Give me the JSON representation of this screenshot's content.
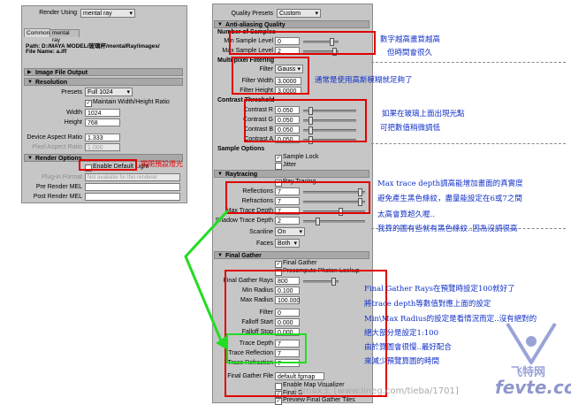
{
  "left_panel": {
    "render_using_label": "Render Using",
    "render_using_value": "mental ray",
    "tabs": [
      "Common",
      "mental ray"
    ],
    "path": "Path: D:/MAYA MODEL/玻璃杯/mentalRay/images/",
    "file_name": "File Name:     a.iff",
    "sections": {
      "image_file_output": "Image File Output",
      "resolution": "Resolution",
      "render_options": "Render Options"
    },
    "presets_label": "Presets",
    "presets_value": "Full 1024",
    "maintain_ratio": "Maintain Width/Height Ratio",
    "width_label": "Width",
    "width_value": "1024",
    "height_label": "Height",
    "height_value": "768",
    "device_aspect_label": "Device Aspect Ratio",
    "device_aspect_value": "1.333",
    "pixel_aspect_label": "Pixel Aspect Ratio",
    "pixel_aspect_value": "1.000",
    "enable_default_light": "Enable Default Light",
    "plugin_format_label": "Plug-in Format",
    "plugin_format_value": "Not available for this renderer",
    "pre_render_label": "Pre Render MEL",
    "post_render_label": "Post Render MEL",
    "note_default_light": "關閉預設燈光"
  },
  "right_panel": {
    "quality_presets_label": "Quality Presets",
    "quality_presets_value": "Custom",
    "antialias_head": "Anti-aliasing Quality",
    "num_samples_head": "Number of Samples",
    "min_sample_label": "Min Sample Level",
    "min_sample_value": "0",
    "max_sample_label": "Max Sample Level",
    "max_sample_value": "2",
    "multipixel_head": "Multi-pixel Filtering",
    "filter_label": "Filter",
    "filter_value": "Gauss",
    "filter_width_label": "Filter Width",
    "filter_width_value": "3.0000",
    "filter_height_label": "Filter Height",
    "filter_height_value": "3.0000",
    "contrast_head": "Contrast Threshold",
    "contrast_rows": [
      {
        "label": "Contrast R",
        "value": "0.050"
      },
      {
        "label": "Contrast G",
        "value": "0.050"
      },
      {
        "label": "Contrast B",
        "value": "0.050"
      },
      {
        "label": "Contrast A",
        "value": "0.050"
      }
    ],
    "sample_options_head": "Sample Options",
    "sample_lock": "Sample Lock",
    "jitter": "Jitter",
    "raytracing_head": "Raytracing",
    "raytracing_chk": "Ray Tracing",
    "reflections_label": "Reflections",
    "reflections_value": "7",
    "refractions_label": "Refractions",
    "refractions_value": "7",
    "max_trace_label": "Max Trace Depth",
    "max_trace_value": "7",
    "shadow_trace_label": "Shadow Trace Depth",
    "shadow_trace_value": "2",
    "scanline_label": "Scanline",
    "scanline_value": "On",
    "faces_label": "Faces",
    "faces_value": "Both",
    "final_gather_head": "Final Gather",
    "final_gather_chk": "Final Gather",
    "precompute_chk": "Precompute Photon Lookup",
    "fg_rays_label": "Final Gather Rays",
    "fg_rays_value": "800",
    "min_radius_label": "Min Radius",
    "min_radius_value": "0.100",
    "max_radius_label": "Max Radius",
    "max_radius_value": "100.000",
    "filter2_label": "Filter",
    "filter2_value": "0",
    "falloff_start_label": "Falloff Start",
    "falloff_start_value": "0.000",
    "falloff_stop_label": "Falloff Stop",
    "falloff_stop_value": "0.000",
    "trace_depth_label": "Trace Depth",
    "trace_depth_value": "7",
    "trace_reflection_label": "Trace Reflection",
    "trace_reflection_value": "7",
    "trace_refraction_label": "Trace Refraction",
    "trace_refraction_value": "7",
    "fg_file_label": "Final Gather File",
    "fg_file_value": "default.fgmap",
    "enable_map_vis": "Enable Map Visualizer",
    "final_g_rebuild": "Final G",
    "preview_fg": "Preview Final Gather Tiles"
  },
  "annotations": {
    "samples_1": "數字越高畫質越高",
    "samples_2": "但時間會很久",
    "filter_1": "通常是使用高斯模糊就足夠了",
    "contrast_1": "如果在玻璃上面出現光點",
    "contrast_2": "可把數值稍微調低",
    "ray_1": "Max trace depth調高能增加畫面的真實度",
    "ray_2": "避免產生黑色條紋，盡量能設定在6或7之間",
    "ray_3": "太高會算超久喔..",
    "ray_4": "我算的圖有些就有黑色條紋..因為沒調很高",
    "fg_1": "Final Gather Rays在預覽時設定100就好了",
    "fg_2": "將trace depth等數值對應上面的設定",
    "fg_3": "Min\\Max Radius的設定是看情況而定..沒有絕對的",
    "fg_4": "絕大部分是設定1:100",
    "fg_5": "由於算圖會很慢..最好配合",
    "fg_6": "來減少預覽算圖的時間"
  },
  "watermark": {
    "brand": "飞特网",
    "site": "fevte.com",
    "footer": "3dmax王 [www.lineg.com/tieba/1701]"
  },
  "colors": {
    "highlight_red": "#e00000",
    "highlight_green": "#22dd22",
    "note_blue": "#1030c8"
  }
}
